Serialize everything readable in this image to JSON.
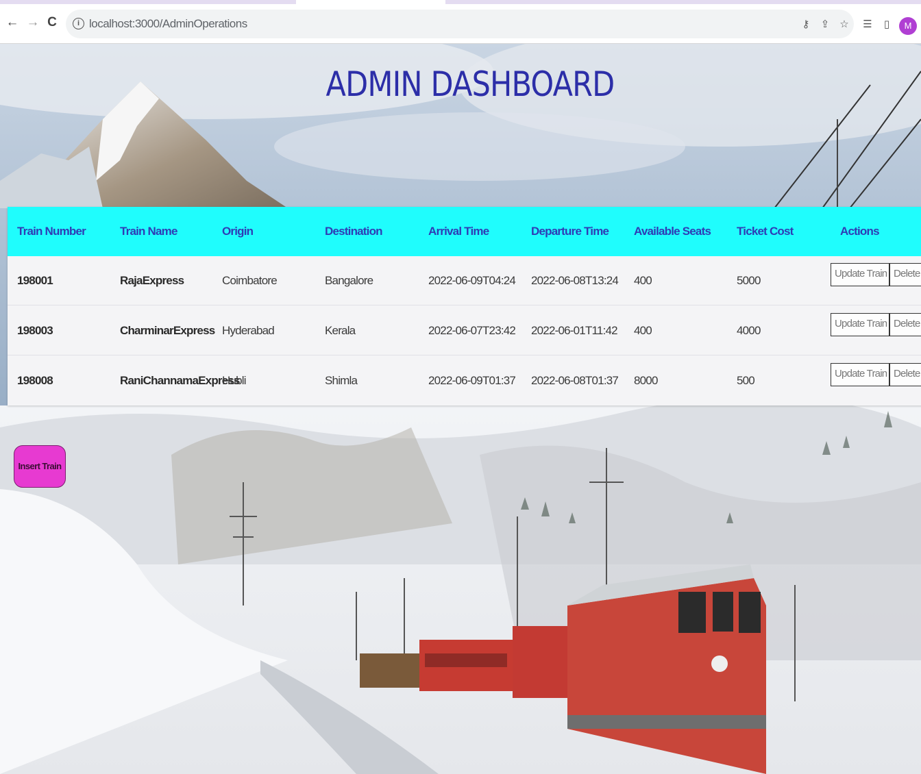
{
  "browser": {
    "url": "localhost:3000/AdminOperations",
    "avatar_letter": "M",
    "nav": {
      "back": "←",
      "forward": "→",
      "reload": "C"
    },
    "icons": [
      "key-icon",
      "share-icon",
      "star-icon",
      "reading-list-icon",
      "side-panel-icon"
    ]
  },
  "page": {
    "title": "ADMIN DASHBOARD",
    "insert_button": "Insert Train"
  },
  "table": {
    "columns": [
      "Train Number",
      "Train Name",
      "Origin",
      "Destination",
      "Arrival Time",
      "Departure Time",
      "Available Seats",
      "Ticket Cost",
      "Actions"
    ],
    "rows": [
      {
        "number": "198001",
        "name": "RajaExpress",
        "origin": "Coimbatore",
        "destination": "Bangalore",
        "arrival": "2022-06-09T04:24",
        "departure": "2022-06-08T13:24",
        "seats": "400",
        "cost": "5000"
      },
      {
        "number": "198003",
        "name": "CharminarExpress",
        "origin": "Hyderabad",
        "destination": "Kerala",
        "arrival": "2022-06-07T23:42",
        "departure": "2022-06-01T11:42",
        "seats": "400",
        "cost": "4000"
      },
      {
        "number": "198008",
        "name": "RaniChannamaExpress",
        "origin": "Hubli",
        "destination": "Shimla",
        "arrival": "2022-06-09T01:37",
        "departure": "2022-06-08T01:37",
        "seats": "8000",
        "cost": "500"
      }
    ],
    "actions": {
      "update": "Update Train",
      "delete": "Delete"
    }
  },
  "colors": {
    "title": "#2c2ea8",
    "header_bg": "#1ffdfd",
    "header_text": "#2f3cb5",
    "insert_button": "#e73ad1"
  }
}
